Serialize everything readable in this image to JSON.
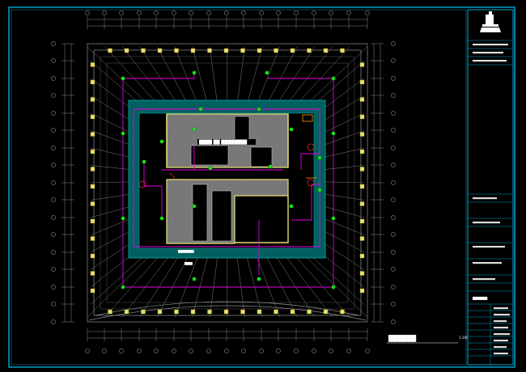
{
  "drawing": {
    "center_label": "████ ██ ████████",
    "sub_label_1": "████████",
    "sub_label_2": "████",
    "plan_title": "██████",
    "scale": "1:100",
    "stamp_text": "███████"
  },
  "colors": {
    "background": "#000000",
    "frame": "#00c8ff",
    "column": "#e8e070",
    "wiring": "#e800e8",
    "device": "#18e018",
    "core_fill": "#006060",
    "room_hatch": "#8c8c8c",
    "structure": "#909090",
    "accent_orange": "#ff9a00",
    "accent_red": "#ff2020"
  },
  "icons": {
    "logo": "building-logo-icon",
    "device": "device-circle-icon",
    "column": "column-square-icon"
  }
}
